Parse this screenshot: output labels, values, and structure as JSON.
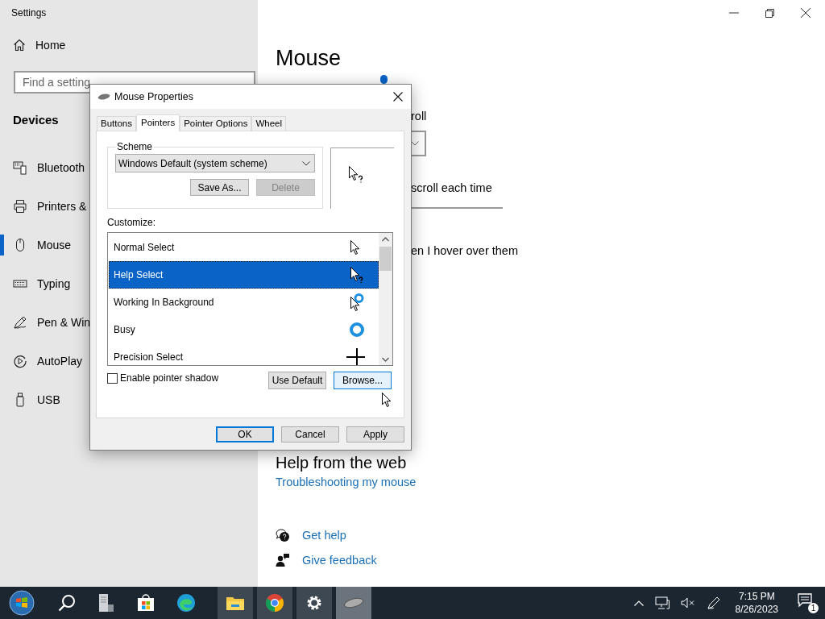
{
  "settings": {
    "title": "Settings",
    "home": "Home",
    "search_placeholder": "Find a setting",
    "section": "Devices",
    "nav": [
      {
        "label": "Bluetooth",
        "selected": false
      },
      {
        "label": "Printers &",
        "selected": false
      },
      {
        "label": "Mouse",
        "selected": true
      },
      {
        "label": "Typing",
        "selected": false
      },
      {
        "label": "Pen & Win",
        "selected": false
      },
      {
        "label": "AutoPlay",
        "selected": false
      },
      {
        "label": "USB",
        "selected": false
      }
    ]
  },
  "main": {
    "heading": "Mouse",
    "fragments": [
      "roll",
      "scroll each time",
      "en I hover over them"
    ],
    "web_heading": "Help from the web",
    "web_link": "Troubleshooting my mouse",
    "help_links": [
      "Get help",
      "Give feedback"
    ]
  },
  "dialog": {
    "title": "Mouse Properties",
    "tabs": [
      {
        "label": "Buttons",
        "selected": false
      },
      {
        "label": "Pointers",
        "selected": true
      },
      {
        "label": "Pointer Options",
        "selected": false
      },
      {
        "label": "Wheel",
        "selected": false
      }
    ],
    "scheme_label": "Scheme",
    "scheme_value": "Windows Default (system scheme)",
    "save_as": {
      "label": "Save As...",
      "disabled": false
    },
    "delete": {
      "label": "Delete",
      "disabled": true
    },
    "customize_label": "Customize:",
    "pointers": [
      {
        "name": "Normal Select",
        "selected": false
      },
      {
        "name": "Help Select",
        "selected": true
      },
      {
        "name": "Working In Background",
        "selected": false
      },
      {
        "name": "Busy",
        "selected": false
      },
      {
        "name": "Precision Select",
        "selected": false
      }
    ],
    "shadow": {
      "label": "Enable pointer shadow",
      "checked": false
    },
    "use_default": "Use Default",
    "browse": "Browse...",
    "buttons": [
      "OK",
      "Cancel",
      "Apply"
    ]
  },
  "taskbar": {
    "apps": [
      {
        "active": true
      },
      {
        "active": true
      },
      {
        "active": true
      },
      {
        "active": true
      }
    ],
    "time": "7:15 PM",
    "date": "8/26/2023",
    "notifications": "1"
  }
}
